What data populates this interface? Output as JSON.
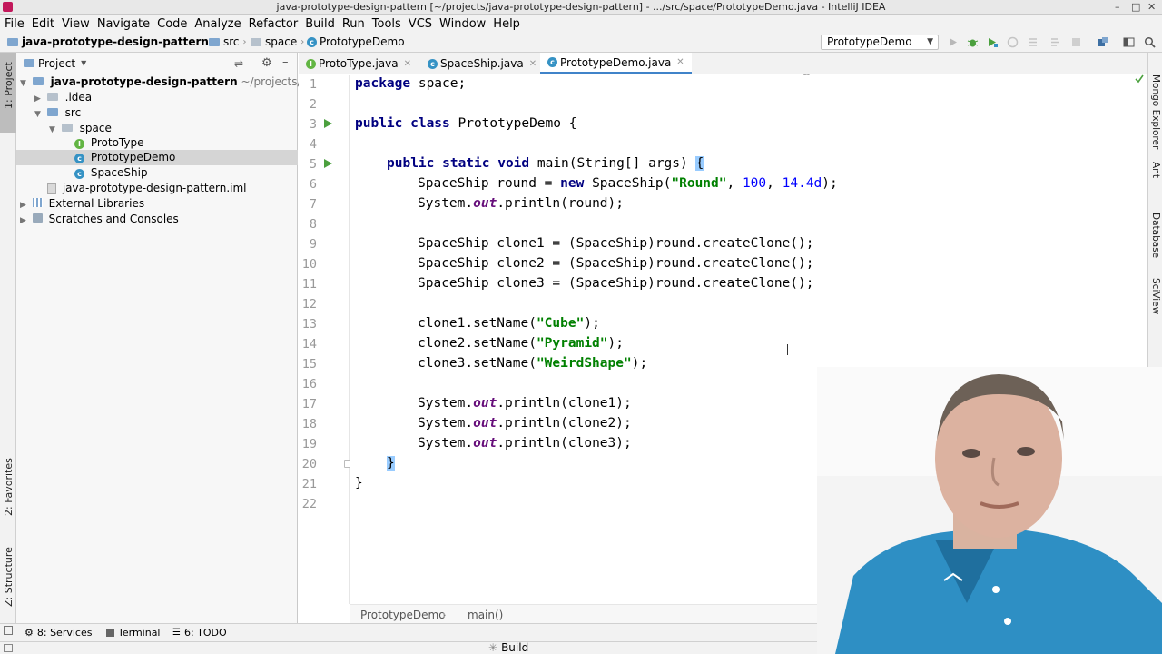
{
  "window": {
    "title": "java-prototype-design-pattern [~/projects/java-prototype-design-pattern] - .../src/space/PrototypeDemo.java - IntelliJ IDEA",
    "controls": [
      "–",
      "□",
      "✕"
    ]
  },
  "menu": [
    "File",
    "Edit",
    "View",
    "Navigate",
    "Code",
    "Analyze",
    "Refactor",
    "Build",
    "Run",
    "Tools",
    "VCS",
    "Window",
    "Help"
  ],
  "navbar": {
    "crumbs": [
      "java-prototype-design-pattern",
      "src",
      "space",
      "PrototypeDemo"
    ],
    "run_config": "PrototypeDemo"
  },
  "left_stripe": {
    "project_tab": "1: Project",
    "favorites_tab": "2: Favorites",
    "structure_tab": "Z: Structure"
  },
  "project_panel": {
    "header": "Project",
    "tree": [
      {
        "label": "java-prototype-design-pattern",
        "suffix": "~/projects/"
      },
      {
        "label": ".idea"
      },
      {
        "label": "src"
      },
      {
        "label": "space"
      },
      {
        "label": "ProtoType"
      },
      {
        "label": "PrototypeDemo"
      },
      {
        "label": "SpaceShip"
      },
      {
        "label": "java-prototype-design-pattern.iml"
      },
      {
        "label": "External Libraries"
      },
      {
        "label": "Scratches and Consoles"
      }
    ]
  },
  "tabs": [
    "ProtoType.java",
    "SpaceShip.java",
    "PrototypeDemo.java"
  ],
  "line_numbers": [
    "1",
    "2",
    "3",
    "4",
    "5",
    "6",
    "7",
    "8",
    "9",
    "10",
    "11",
    "12",
    "13",
    "14",
    "15",
    "16",
    "17",
    "18",
    "19",
    "20",
    "21",
    "22"
  ],
  "code": {
    "l1_kw": "package",
    "l1_rest": " space;",
    "l3_kw": "public class",
    "l3_rest": " PrototypeDemo {",
    "l5_kw": "public static void",
    "l5_rest": " main(String[] args) ",
    "l5_brace": "{",
    "l6_a": "SpaceShip round = ",
    "l6_new": "new",
    "l6_b": " SpaceShip(",
    "l6_str": "\"Round\"",
    "l6_c": ", ",
    "l6_n1": "100",
    "l6_d": ", ",
    "l6_n2": "14.4d",
    "l6_e": ");",
    "l7_a": "System.",
    "l7_out": "out",
    "l7_b": ".println(round);",
    "l9": "SpaceShip clone1 = (SpaceShip)round.createClone();",
    "l10": "SpaceShip clone2 = (SpaceShip)round.createClone();",
    "l11": "SpaceShip clone3 = (SpaceShip)round.createClone();",
    "l13_a": "clone1.setName(",
    "l13_s": "\"Cube\"",
    "l13_b": ");",
    "l14_a": "clone2.setName(",
    "l14_s": "\"Pyramid\"",
    "l14_b": ");",
    "l15_a": "clone3.setName(",
    "l15_s": "\"WeirdShape\"",
    "l15_b": ");",
    "l17_a": "System.",
    "l17_out": "out",
    "l17_b": ".println(clone1);",
    "l18_a": "System.",
    "l18_out": "out",
    "l18_b": ".println(clone2);",
    "l19_a": "System.",
    "l19_out": "out",
    "l19_b": ".println(clone3);",
    "l20": "}",
    "l21": "}"
  },
  "editor_crumbs": [
    "PrototypeDemo",
    "main()"
  ],
  "right_stripe": [
    "Mongo Explorer",
    "Ant",
    "Database",
    "SciView"
  ],
  "bottom_tools": [
    "8: Services",
    "Terminal",
    "6: TODO"
  ],
  "status": {
    "build": "Build"
  },
  "colors": {
    "accent": "#4083c9",
    "keyword": "#000080",
    "string": "#008000",
    "number": "#0000ff",
    "run_green": "#4ba03e"
  }
}
